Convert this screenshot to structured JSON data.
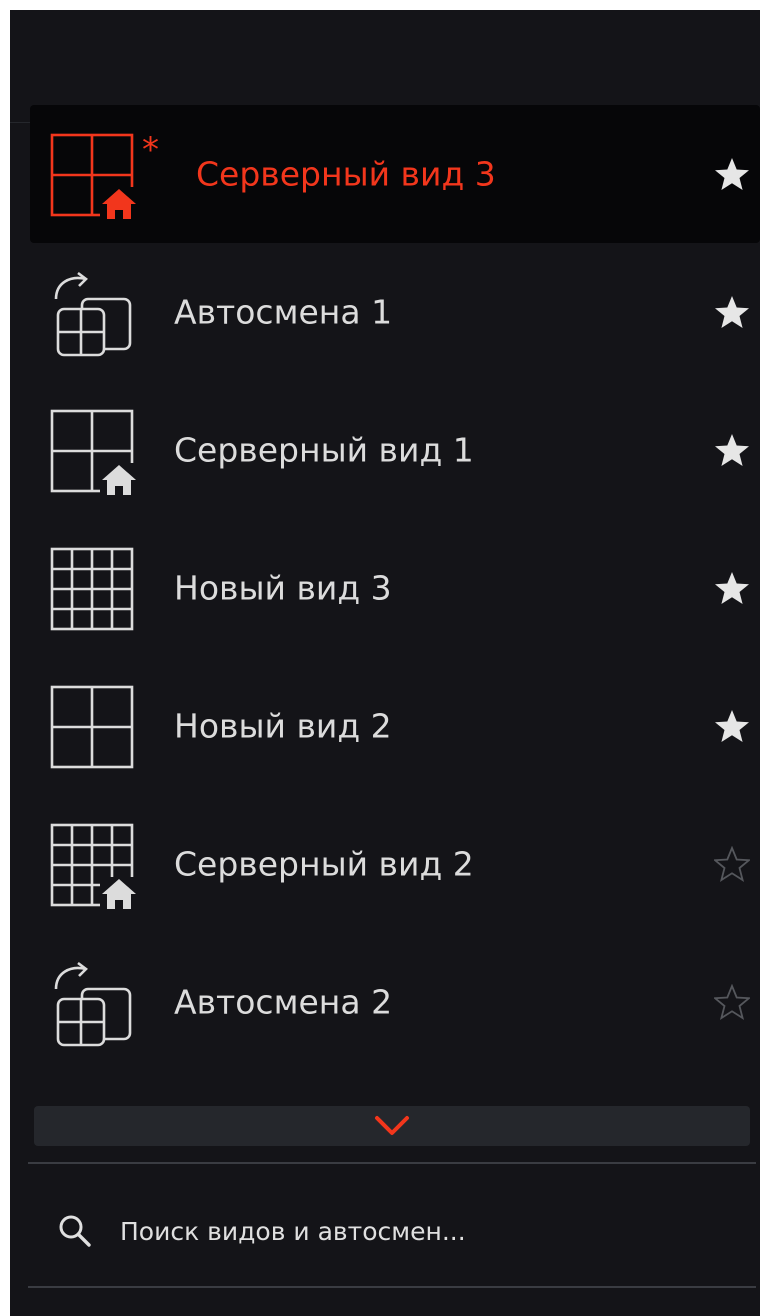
{
  "colors": {
    "accent": "#f2361c",
    "text": "#dcdcdc",
    "background": "#141418",
    "star_filled": "#e6e6e6",
    "star_empty": "#55575c"
  },
  "views": [
    {
      "label": "Серверный вид 3",
      "icon": "layout-2x2-server-icon",
      "favorite": true,
      "active": true,
      "modified_marker": "*"
    },
    {
      "label": "Автосмена 1",
      "icon": "autoswitch-icon",
      "favorite": true,
      "active": false
    },
    {
      "label": "Серверный вид 1",
      "icon": "layout-2x2-server-icon",
      "favorite": true,
      "active": false
    },
    {
      "label": "Новый вид 3",
      "icon": "layout-4x4-icon",
      "favorite": true,
      "active": false
    },
    {
      "label": "Новый вид 2",
      "icon": "layout-2x2-icon",
      "favorite": true,
      "active": false
    },
    {
      "label": "Серверный вид 2",
      "icon": "layout-4x4-server-icon",
      "favorite": false,
      "active": false
    },
    {
      "label": "Автосмена 2",
      "icon": "autoswitch-icon",
      "favorite": false,
      "active": false
    }
  ],
  "expand": {
    "icon": "chevron-down-icon"
  },
  "search": {
    "placeholder": "Поиск видов и автосмен...",
    "value": "",
    "icon": "search-icon"
  }
}
